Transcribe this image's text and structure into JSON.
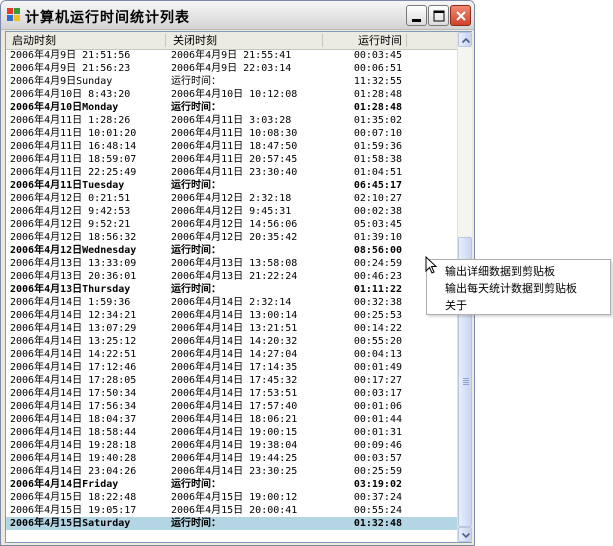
{
  "window": {
    "title": "计算机运行时间统计列表"
  },
  "columns": [
    "启动时刻",
    "关闭时刻",
    "运行时间"
  ],
  "rows": [
    {
      "c1": "2006年4月9日 21:51:56",
      "c2": "2006年4月9日 21:55:41",
      "c3": "00:03:45",
      "bold": false
    },
    {
      "c1": "2006年4月9日 21:56:23",
      "c2": "2006年4月9日 22:03:14",
      "c3": "00:06:51",
      "bold": false
    },
    {
      "c1": "2006年4月9日Sunday",
      "c2": "运行时间：",
      "c3": "11:32:55",
      "bold": false
    },
    {
      "c1": "2006年4月10日 8:43:20",
      "c2": "2006年4月10日 10:12:08",
      "c3": "01:28:48",
      "bold": false
    },
    {
      "c1": "2006年4月10日Monday",
      "c2": "运行时间：",
      "c3": "01:28:48",
      "bold": true
    },
    {
      "c1": "2006年4月11日 1:28:26",
      "c2": "2006年4月11日 3:03:28",
      "c3": "01:35:02",
      "bold": false
    },
    {
      "c1": "2006年4月11日 10:01:20",
      "c2": "2006年4月11日 10:08:30",
      "c3": "00:07:10",
      "bold": false
    },
    {
      "c1": "2006年4月11日 16:48:14",
      "c2": "2006年4月11日 18:47:50",
      "c3": "01:59:36",
      "bold": false
    },
    {
      "c1": "2006年4月11日 18:59:07",
      "c2": "2006年4月11日 20:57:45",
      "c3": "01:58:38",
      "bold": false
    },
    {
      "c1": "2006年4月11日 22:25:49",
      "c2": "2006年4月11日 23:30:40",
      "c3": "01:04:51",
      "bold": false
    },
    {
      "c1": "2006年4月11日Tuesday",
      "c2": "运行时间：",
      "c3": "06:45:17",
      "bold": true
    },
    {
      "c1": "2006年4月12日 0:21:51",
      "c2": "2006年4月12日 2:32:18",
      "c3": "02:10:27",
      "bold": false
    },
    {
      "c1": "2006年4月12日 9:42:53",
      "c2": "2006年4月12日 9:45:31",
      "c3": "00:02:38",
      "bold": false
    },
    {
      "c1": "2006年4月12日 9:52:21",
      "c2": "2006年4月12日 14:56:06",
      "c3": "05:03:45",
      "bold": false
    },
    {
      "c1": "2006年4月12日 18:56:32",
      "c2": "2006年4月12日 20:35:42",
      "c3": "01:39:10",
      "bold": false
    },
    {
      "c1": "2006年4月12日Wednesday",
      "c2": "运行时间：",
      "c3": "08:56:00",
      "bold": true
    },
    {
      "c1": "2006年4月13日 13:33:09",
      "c2": "2006年4月13日 13:58:08",
      "c3": "00:24:59",
      "bold": false
    },
    {
      "c1": "2006年4月13日 20:36:01",
      "c2": "2006年4月13日 21:22:24",
      "c3": "00:46:23",
      "bold": false
    },
    {
      "c1": "2006年4月13日Thursday",
      "c2": "运行时间：",
      "c3": "01:11:22",
      "bold": true
    },
    {
      "c1": "2006年4月14日 1:59:36",
      "c2": "2006年4月14日 2:32:14",
      "c3": "00:32:38",
      "bold": false
    },
    {
      "c1": "2006年4月14日 12:34:21",
      "c2": "2006年4月14日 13:00:14",
      "c3": "00:25:53",
      "bold": false
    },
    {
      "c1": "2006年4月14日 13:07:29",
      "c2": "2006年4月14日 13:21:51",
      "c3": "00:14:22",
      "bold": false
    },
    {
      "c1": "2006年4月14日 13:25:12",
      "c2": "2006年4月14日 14:20:32",
      "c3": "00:55:20",
      "bold": false
    },
    {
      "c1": "2006年4月14日 14:22:51",
      "c2": "2006年4月14日 14:27:04",
      "c3": "00:04:13",
      "bold": false
    },
    {
      "c1": "2006年4月14日 17:12:46",
      "c2": "2006年4月14日 17:14:35",
      "c3": "00:01:49",
      "bold": false
    },
    {
      "c1": "2006年4月14日 17:28:05",
      "c2": "2006年4月14日 17:45:32",
      "c3": "00:17:27",
      "bold": false
    },
    {
      "c1": "2006年4月14日 17:50:34",
      "c2": "2006年4月14日 17:53:51",
      "c3": "00:03:17",
      "bold": false
    },
    {
      "c1": "2006年4月14日 17:56:34",
      "c2": "2006年4月14日 17:57:40",
      "c3": "00:01:06",
      "bold": false
    },
    {
      "c1": "2006年4月14日 18:04:37",
      "c2": "2006年4月14日 18:06:21",
      "c3": "00:01:44",
      "bold": false
    },
    {
      "c1": "2006年4月14日 18:58:44",
      "c2": "2006年4月14日 19:00:15",
      "c3": "00:01:31",
      "bold": false
    },
    {
      "c1": "2006年4月14日 19:28:18",
      "c2": "2006年4月14日 19:38:04",
      "c3": "00:09:46",
      "bold": false
    },
    {
      "c1": "2006年4月14日 19:40:28",
      "c2": "2006年4月14日 19:44:25",
      "c3": "00:03:57",
      "bold": false
    },
    {
      "c1": "2006年4月14日 23:04:26",
      "c2": "2006年4月14日 23:30:25",
      "c3": "00:25:59",
      "bold": false
    },
    {
      "c1": "2006年4月14日Friday",
      "c2": "运行时间：",
      "c3": "03:19:02",
      "bold": true
    },
    {
      "c1": "2006年4月15日 18:22:48",
      "c2": "2006年4月15日 19:00:12",
      "c3": "00:37:24",
      "bold": false
    },
    {
      "c1": "2006年4月15日 19:05:17",
      "c2": "2006年4月15日 20:00:41",
      "c3": "00:55:24",
      "bold": false
    },
    {
      "c1": "2006年4月15日Saturday",
      "c2": "运行时间：",
      "c3": "01:32:48",
      "bold": true,
      "selected": true
    }
  ],
  "context_menu": {
    "items": [
      "输出详细数据到剪贴板",
      "输出每天统计数据到剪贴板",
      "关于"
    ]
  },
  "colors": {
    "selection": "#b4d6e4",
    "close_button": "#d1412b",
    "frame_border": "#7f9db9"
  },
  "icons": [
    "app-icon",
    "minimize-icon",
    "maximize-icon",
    "close-icon",
    "scroll-up-arrow-icon",
    "scroll-down-arrow-icon",
    "mouse-cursor-icon"
  ]
}
